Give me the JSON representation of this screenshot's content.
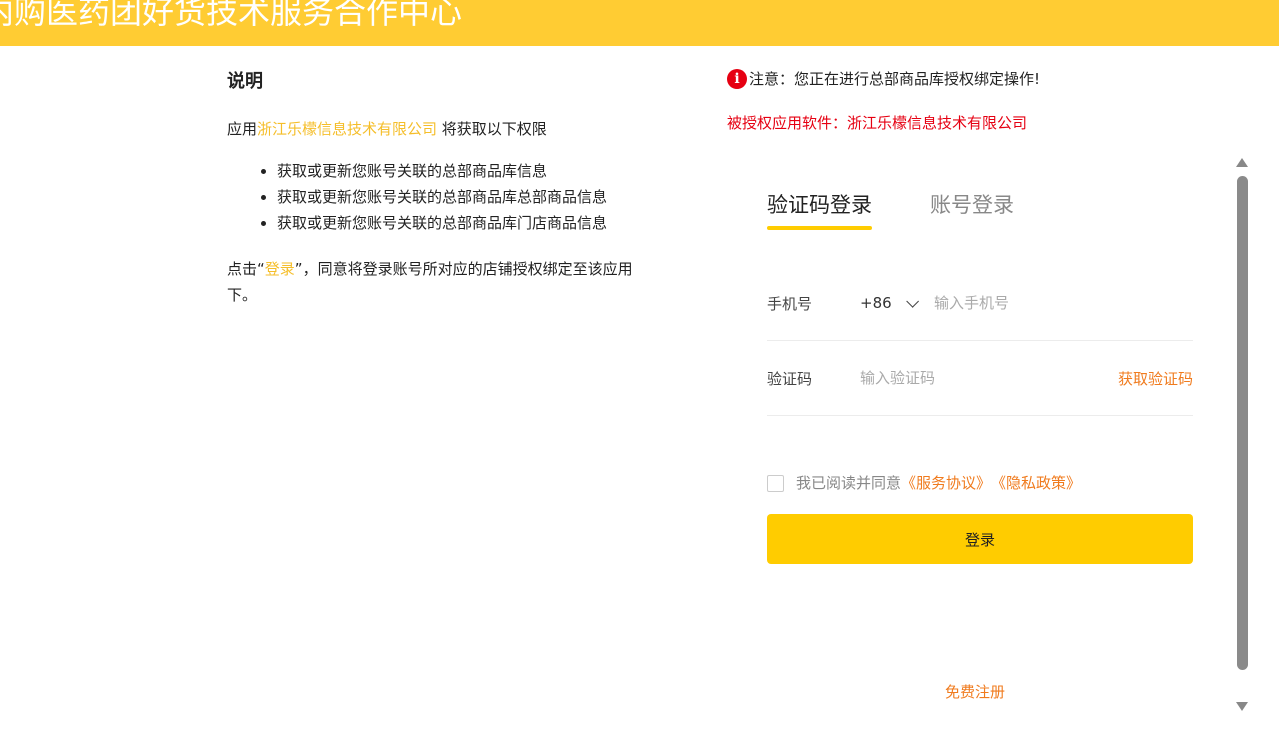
{
  "header": {
    "title": "内购医药团好货技术服务合作中心"
  },
  "description": {
    "title": "说明",
    "intro_prefix": "应用",
    "company": "浙江乐檬信息技术有限公司",
    "intro_suffix": " 将获取以下权限",
    "permissions": [
      "获取或更新您账号关联的总部商品库信息",
      "获取或更新您账号关联的总部商品库总部商品信息",
      "获取或更新您账号关联的总部商品库门店商品信息"
    ],
    "outro_prefix": "点击“",
    "outro_link": "登录",
    "outro_suffix": "”，同意将登录账号所对应的店铺授权绑定至该应用下。"
  },
  "notice": {
    "icon": "info-icon",
    "text": "注意：您正在进行总部商品库授权绑定操作!",
    "authorized_app": "被授权应用软件：浙江乐檬信息技术有限公司",
    "color": "#e60012"
  },
  "login": {
    "tabs": [
      {
        "label": "验证码登录",
        "active": true
      },
      {
        "label": "账号登录",
        "active": false
      }
    ],
    "phone_label": "手机号",
    "country_code": "+86",
    "phone_placeholder": "输入手机号",
    "code_label": "验证码",
    "code_placeholder": "输入验证码",
    "get_code": "获取验证码",
    "agree_prefix": "我已阅读并同意",
    "agree_service": "《服务协议》",
    "agree_privacy": "《隐私政策》",
    "submit": "登录",
    "register": "免费注册",
    "accent": "#FFCC00",
    "link_color": "#F07B1E"
  }
}
